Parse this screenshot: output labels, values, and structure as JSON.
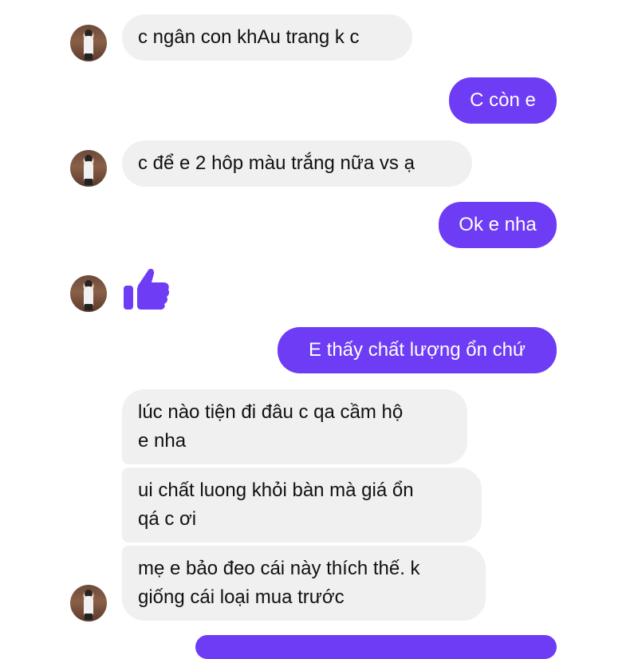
{
  "colors": {
    "outgoing": "#6d3cf4",
    "incoming": "#f0f0f0"
  },
  "messages": [
    {
      "from": "contact",
      "text": "c ngân con khAu trang k c"
    },
    {
      "from": "me",
      "text": "C còn e"
    },
    {
      "from": "contact",
      "text": "c để e 2 hôp màu trắng nữa vs ạ"
    },
    {
      "from": "me",
      "text": "Ok e nha"
    },
    {
      "from": "contact",
      "icon": "thumbs-up-icon"
    },
    {
      "from": "me",
      "text": "E thấy chất lượng ổn chứ"
    },
    {
      "from": "contact",
      "lines": [
        "lúc nào tiện đi đâu c qa cầm hộ",
        "e nha"
      ]
    },
    {
      "from": "contact",
      "lines": [
        "ui chất luong khỏi bàn mà giá ổn",
        "qá c ơi"
      ]
    },
    {
      "from": "contact",
      "lines": [
        "mẹ e bảo đeo cái này thích thế. k",
        "giống cái loại mua trước"
      ]
    }
  ]
}
